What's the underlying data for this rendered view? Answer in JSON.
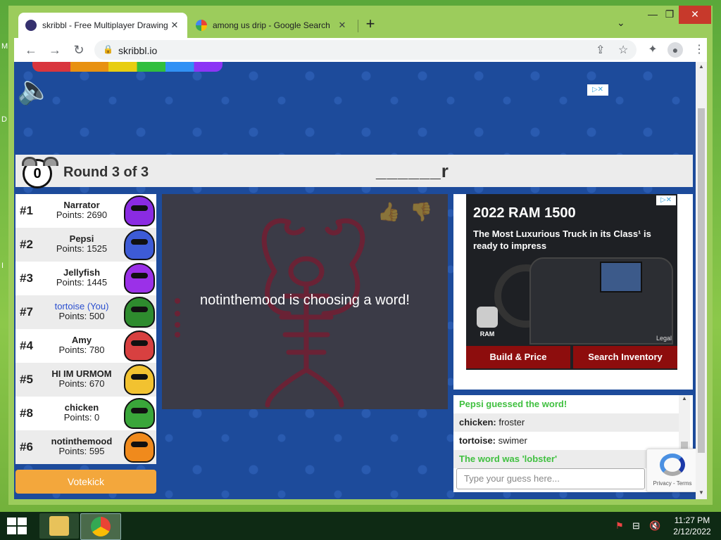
{
  "desktop": {
    "side_letters": [
      "M",
      "D",
      "I"
    ]
  },
  "browser": {
    "tabs": [
      {
        "title": "skribbl - Free Multiplayer Drawing",
        "active": true
      },
      {
        "title": "among us drip - Google Search",
        "active": false
      }
    ],
    "url": "skribbl.io",
    "window_controls": {
      "minimize": "—",
      "maximize": "❐",
      "close": "✕"
    }
  },
  "game": {
    "timer": "0",
    "round_text": "Round 3 of 3",
    "word_hint": "______r",
    "players": [
      {
        "rank": "#1",
        "name": "Narrator",
        "points": "Points: 2690",
        "color": "#8a2be2",
        "you": false
      },
      {
        "rank": "#2",
        "name": "Pepsi",
        "points": "Points: 1525",
        "color": "#3d5bd6",
        "you": false
      },
      {
        "rank": "#3",
        "name": "Jellyfish",
        "points": "Points: 1445",
        "color": "#9b30e8",
        "you": false
      },
      {
        "rank": "#7",
        "name": "tortoise (You)",
        "points": "Points: 500",
        "color": "#2e8b2e",
        "you": true
      },
      {
        "rank": "#4",
        "name": "Amy",
        "points": "Points: 780",
        "color": "#d84040",
        "you": false
      },
      {
        "rank": "#5",
        "name": "HI IM URMOM",
        "points": "Points: 670",
        "color": "#f2c230",
        "you": false
      },
      {
        "rank": "#8",
        "name": "chicken",
        "points": "Points: 0",
        "color": "#3aa63a",
        "you": false
      },
      {
        "rank": "#6",
        "name": "notinthemood",
        "points": "Points: 595",
        "color": "#f08a1c",
        "you": false
      }
    ],
    "votekick_label": "Votekick",
    "canvas_overlay": "notinthemood is choosing a word!"
  },
  "ad": {
    "title": "2022 RAM 1500",
    "subtitle": "The Most Luxurious Truck in its Class¹ is ready to impress",
    "brand": "RAM",
    "legal": "Legal",
    "buttons": [
      "Build & Price",
      "Search Inventory"
    ]
  },
  "chat": {
    "messages": [
      {
        "type": "system",
        "text": "Pepsi guessed the word!"
      },
      {
        "type": "user",
        "user": "chicken:",
        "text": " froster"
      },
      {
        "type": "user",
        "user": "tortoise:",
        "text": " swimer"
      },
      {
        "type": "system",
        "text": "The word was 'lobster'"
      }
    ],
    "input_placeholder": "Type your guess here...",
    "recaptcha_text": "Privacy - Terms"
  },
  "taskbar": {
    "time": "11:27 PM",
    "date": "2/12/2022"
  }
}
